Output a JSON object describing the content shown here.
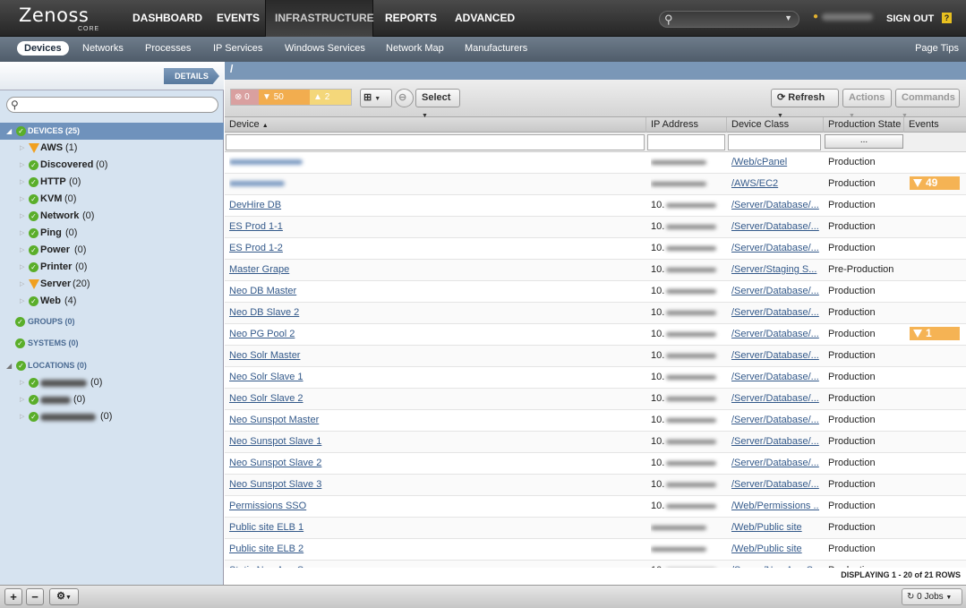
{
  "app": {
    "brand": "Zenoss",
    "edition": "CORE"
  },
  "mainnav": [
    {
      "label": "DASHBOARD",
      "active": false
    },
    {
      "label": "EVENTS",
      "active": false
    },
    {
      "label": "INFRASTRUCTURE",
      "active": true
    },
    {
      "label": "REPORTS",
      "active": false
    },
    {
      "label": "ADVANCED",
      "active": false
    }
  ],
  "header": {
    "signout": "SIGN OUT",
    "help": "?"
  },
  "subnav": [
    {
      "label": "Devices",
      "active": true
    },
    {
      "label": "Networks"
    },
    {
      "label": "Processes"
    },
    {
      "label": "IP Services"
    },
    {
      "label": "Windows Services"
    },
    {
      "label": "Network Map"
    },
    {
      "label": "Manufacturers"
    }
  ],
  "pagetips": "Page Tips",
  "left": {
    "details": "DETAILS",
    "tree": [
      {
        "label": "DEVICES (25)",
        "status": "ok",
        "type": "group",
        "selected": true
      },
      {
        "label": "AWS",
        "count": "(1)",
        "status": "warn"
      },
      {
        "label": "Discovered",
        "count": "(0)",
        "status": "ok"
      },
      {
        "label": "HTTP",
        "count": "(0)",
        "status": "ok"
      },
      {
        "label": "KVM",
        "count": "(0)",
        "status": "ok"
      },
      {
        "label": "Network",
        "count": "(0)",
        "status": "ok"
      },
      {
        "label": "Ping",
        "count": "(0)",
        "status": "ok"
      },
      {
        "label": "Power",
        "count": "(0)",
        "status": "ok"
      },
      {
        "label": "Printer",
        "count": "(0)",
        "status": "ok"
      },
      {
        "label": "Server",
        "count": "(20)",
        "status": "warn"
      },
      {
        "label": "Web",
        "count": "(4)",
        "status": "ok"
      }
    ],
    "groups": "GROUPS (0)",
    "systems": "SYSTEMS (0)",
    "locations": "LOCATIONS (0)",
    "location_counts": [
      "(0)",
      "(0)",
      "(0)"
    ]
  },
  "main": {
    "path": "/",
    "severity": {
      "critical": "0",
      "error": "50",
      "warning": "2"
    },
    "select": "Select",
    "refresh": "Refresh",
    "actions": "Actions",
    "commands": "Commands",
    "columns": [
      "Device",
      "IP Address",
      "Device Class",
      "Production State",
      "Events"
    ],
    "prodstate_filter": "...",
    "rows": [
      {
        "device": "",
        "ip": "",
        "class": "/Web/cPanel",
        "state": "Production",
        "events": ""
      },
      {
        "device": "",
        "ip": "",
        "class": "/AWS/EC2",
        "state": "Production",
        "events": "49"
      },
      {
        "device": "DevHire DB",
        "ip": "10.",
        "class": "/Server/Database/...",
        "state": "Production",
        "events": ""
      },
      {
        "device": "ES Prod 1-1",
        "ip": "10.",
        "class": "/Server/Database/...",
        "state": "Production",
        "events": ""
      },
      {
        "device": "ES Prod 1-2",
        "ip": "10.",
        "class": "/Server/Database/...",
        "state": "Production",
        "events": ""
      },
      {
        "device": "Master Grape",
        "ip": "10.",
        "class": "/Server/Staging S...",
        "state": "Pre-Production",
        "events": ""
      },
      {
        "device": "Neo DB Master",
        "ip": "10.",
        "class": "/Server/Database/...",
        "state": "Production",
        "events": ""
      },
      {
        "device": "Neo DB Slave 2",
        "ip": "10.",
        "class": "/Server/Database/...",
        "state": "Production",
        "events": ""
      },
      {
        "device": "Neo PG Pool 2",
        "ip": "10.",
        "class": "/Server/Database/...",
        "state": "Production",
        "events": "1"
      },
      {
        "device": "Neo Solr Master",
        "ip": "10.",
        "class": "/Server/Database/...",
        "state": "Production",
        "events": ""
      },
      {
        "device": "Neo Solr Slave 1",
        "ip": "10.",
        "class": "/Server/Database/...",
        "state": "Production",
        "events": ""
      },
      {
        "device": "Neo Solr Slave 2",
        "ip": "10.",
        "class": "/Server/Database/...",
        "state": "Production",
        "events": ""
      },
      {
        "device": "Neo Sunspot Master",
        "ip": "10.",
        "class": "/Server/Database/...",
        "state": "Production",
        "events": ""
      },
      {
        "device": "Neo Sunspot Slave 1",
        "ip": "10.",
        "class": "/Server/Database/...",
        "state": "Production",
        "events": ""
      },
      {
        "device": "Neo Sunspot Slave 2",
        "ip": "10.",
        "class": "/Server/Database/...",
        "state": "Production",
        "events": ""
      },
      {
        "device": "Neo Sunspot Slave 3",
        "ip": "10.",
        "class": "/Server/Database/...",
        "state": "Production",
        "events": ""
      },
      {
        "device": "Permissions SSO",
        "ip": "10.",
        "class": "/Web/Permissions ...",
        "state": "Production",
        "events": ""
      },
      {
        "device": "Public site ELB 1",
        "ip": "",
        "class": "/Web/Public site",
        "state": "Production",
        "events": ""
      },
      {
        "device": "Public site ELB 2",
        "ip": "",
        "class": "/Web/Public site",
        "state": "Production",
        "events": ""
      },
      {
        "device": "Static Neo App Server",
        "ip": "10.",
        "class": "/Server/Neo App S...",
        "state": "Production",
        "events": ""
      }
    ],
    "status": "DISPLAYING 1 - 20 of 21 ROWS"
  },
  "bottom": {
    "jobs": "0 Jobs"
  },
  "colors": {
    "accent": "#6f92bc",
    "ok": "#5aae2a",
    "warn": "#f0a020",
    "critical": "#d27c7c",
    "error": "#f5b354",
    "warning": "#f5d36a"
  }
}
